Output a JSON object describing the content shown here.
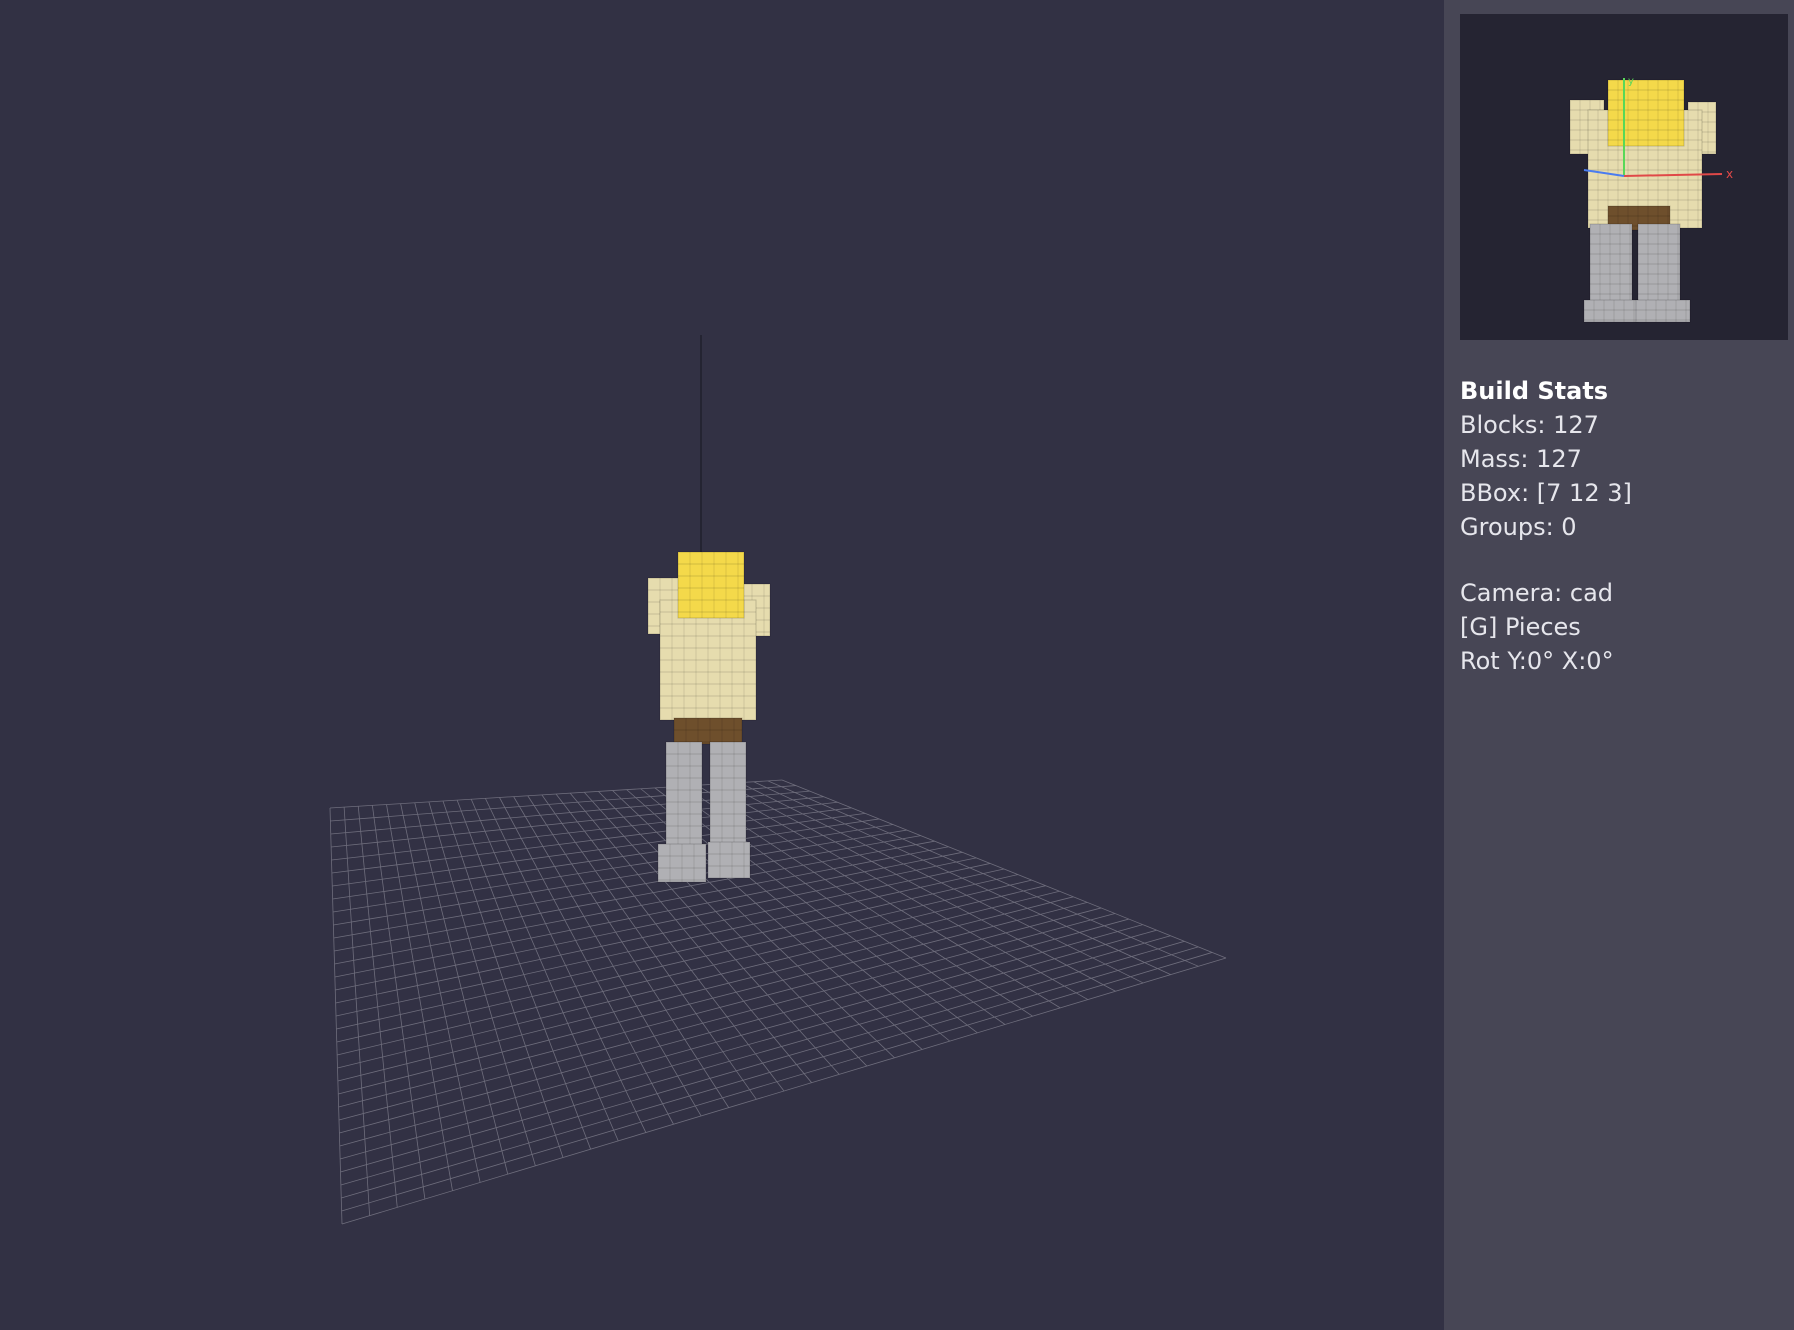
{
  "viewport": {
    "label": "3D viewport",
    "background": "#323144",
    "grid_color": "#6e6d7c"
  },
  "minimap": {
    "background": "#252432",
    "axis_x_label": "x",
    "axis_y_label": "y",
    "axis_colors": {
      "x": "#e04848",
      "y": "#58d858",
      "z": "#4a7cf0"
    }
  },
  "model_colors": {
    "hair": "#f4d94a",
    "shirt": "#e6dcae",
    "belt": "#6e4f2c",
    "legs": "#b0b0b4"
  },
  "stats": {
    "title": "Build Stats",
    "blocks": "Blocks: 127",
    "mass": "Mass: 127",
    "bbox": "BBox: [7 12 3]",
    "groups": "Groups: 0",
    "camera": "Camera: cad",
    "pieces": "[G] Pieces",
    "rotation": "Rot Y:0° X:0°"
  }
}
